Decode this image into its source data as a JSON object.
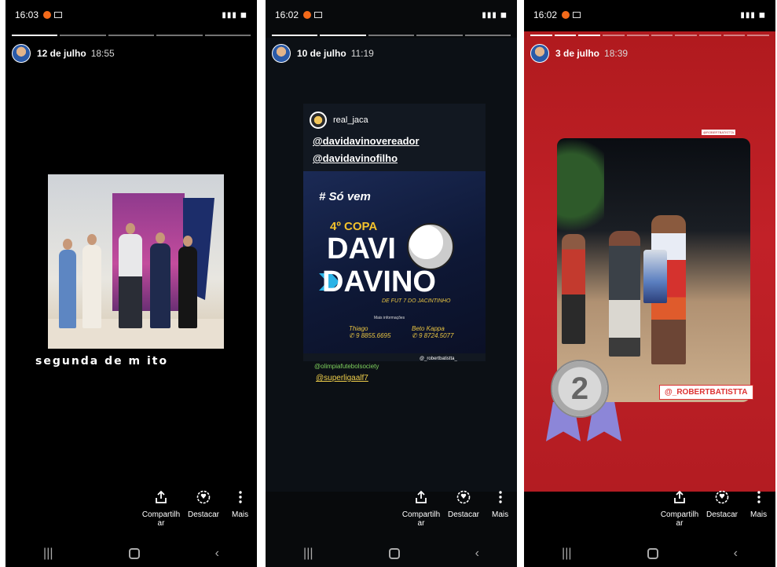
{
  "screens": [
    {
      "status_time": "16:03",
      "story_date": "12 de julho",
      "story_time": "18:55",
      "caption": "segunda de m   ito",
      "actions": {
        "share": "Compartilh ar",
        "highlight": "Destacar",
        "more": "Mais"
      }
    },
    {
      "status_time": "16:02",
      "story_date": "10 de julho",
      "story_time": "11:19",
      "repost_user": "real_jaca",
      "mentions": [
        "@davidavinovereador",
        "@davidavinofilho"
      ],
      "poster": {
        "hashtag": "# Só vem",
        "copa": "4º COPA",
        "line1": "DAVI",
        "line2": "DAVINO",
        "subtitle": "DE FUT 7 DO JACINTINHO",
        "info_label": "Mais informações",
        "contact1_name": "Thiago",
        "contact1_phone": "9 8855.6695",
        "contact2_name": "Beto Kappa",
        "contact2_phone": "9 8724.5077"
      },
      "tag_green": "@olimpiafutebolsociety",
      "tag_white": "@_robertbatistta_",
      "tag_yellow": "@superligaalf7",
      "actions": {
        "share": "Compartilh ar",
        "highlight": "Destacar",
        "more": "Mais"
      }
    },
    {
      "status_time": "16:02",
      "story_date": "3 de julho",
      "story_time": "18:39",
      "tiny_tag": "@ROBERTBATISTTA",
      "handle": "@_ROBERTBATISTTA",
      "medal_number": "2",
      "actions": {
        "share": "Compartilh ar",
        "highlight": "Destacar",
        "more": "Mais"
      }
    }
  ],
  "colors": {
    "story3_bg": "#c22128",
    "poster_yellow": "#f4c22c",
    "tag_green": "#7fd25e"
  },
  "icons": [
    "share-icon",
    "highlight-icon",
    "more-icon",
    "recent-apps-icon",
    "home-icon",
    "back-icon"
  ]
}
